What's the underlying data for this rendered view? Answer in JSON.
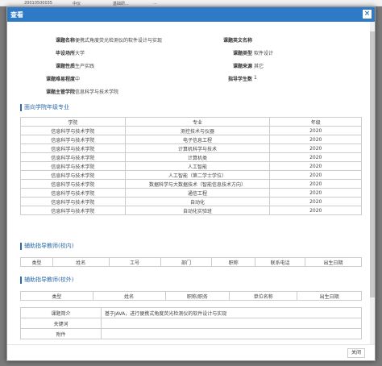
{
  "background_rows": [
    {
      "col1": "20010500035",
      "col2": "中仪",
      "col3": "基础研...",
      "col4": "..."
    },
    {
      "col1": "",
      "col2": "",
      "col3": "",
      "col4": ""
    }
  ],
  "modal": {
    "title": "查看",
    "close_icon": "×",
    "info": {
      "topic_name_label": "课题名称",
      "topic_name_value": "便携式角度荧光检测仪的软件设计与实现",
      "topic_en_label": "课题英文名称",
      "topic_en_value": "",
      "grad_place_label": "毕设场所",
      "grad_place_value": "大学",
      "topic_type_label": "课题类型",
      "topic_type_value": "软件设计",
      "topic_nature_label": "课题性质",
      "topic_nature_value": "生产实践",
      "topic_source_label": "课题来源",
      "topic_source_value": "其它",
      "difficulty_label": "课题难易程度",
      "difficulty_value": "中",
      "student_count_label": "指导学生数",
      "student_count_value": "1",
      "dept_label": "课题主管学院",
      "dept_value": "信息科学与技术学院"
    },
    "majors_section": {
      "title": "面向学院年级专业",
      "headers": [
        "学院",
        "专业",
        "年级"
      ],
      "rows": [
        [
          "信息科学与技术学院",
          "测控技术与仪器",
          "2020"
        ],
        [
          "信息科学与技术学院",
          "电子信息工程",
          "2020"
        ],
        [
          "信息科学与技术学院",
          "计算机科学与技术",
          "2020"
        ],
        [
          "信息科学与技术学院",
          "计算机类",
          "2020"
        ],
        [
          "信息科学与技术学院",
          "人工智能",
          "2020"
        ],
        [
          "信息科学与技术学院",
          "人工智能（第二学士学位）",
          "2020"
        ],
        [
          "信息科学与技术学院",
          "数据科学与大数据技术（智能信息技术方向）",
          "2020"
        ],
        [
          "信息科学与技术学院",
          "通信工程",
          "2020"
        ],
        [
          "信息科学与技术学院",
          "自动化",
          "2020"
        ],
        [
          "信息科学与技术学院",
          "自动化实验班",
          "2020"
        ]
      ]
    },
    "inner_teacher_section": {
      "title": "辅助指导教师(校内)",
      "headers": [
        "类型",
        "姓名",
        "工号",
        "部门",
        "职称",
        "联系电话",
        "出生日期"
      ]
    },
    "outer_teacher_section": {
      "title": "辅助指导教师(校外)",
      "headers": [
        "类型",
        "姓名",
        "职称/职务",
        "单位名称",
        "出生日期"
      ]
    },
    "summary": {
      "intro_label": "课题简介",
      "intro_value": "基于JAVA，进行便携式角度荧光检测仪的软件设计与实现",
      "keywords_label": "关键词",
      "keywords_value": "",
      "attachment_label": "附件",
      "attachment_value": ""
    },
    "footer": {
      "close_label": "关闭"
    }
  },
  "colors": {
    "header_bg": "#2e7ac7",
    "section_title": "#2e6aa8"
  }
}
